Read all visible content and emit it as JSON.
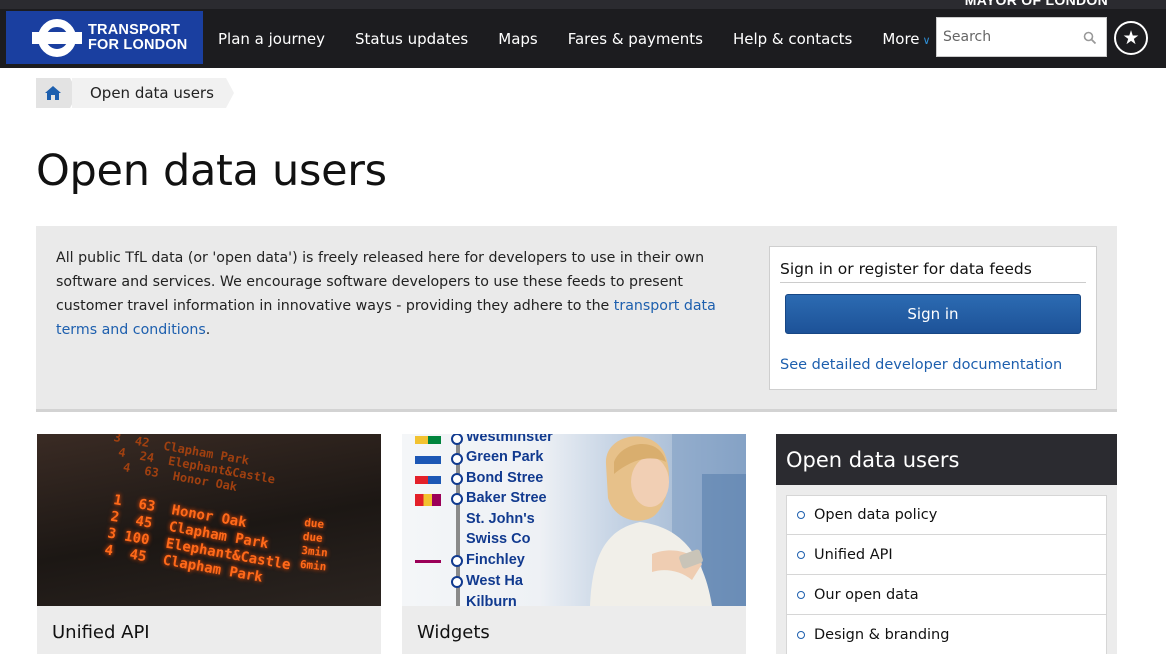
{
  "header": {
    "mayor_text": "MAYOR OF LONDON",
    "logo_line1": "TRANSPORT",
    "logo_line2": "FOR LONDON",
    "nav": [
      {
        "label": "Plan a journey"
      },
      {
        "label": "Status updates"
      },
      {
        "label": "Maps"
      },
      {
        "label": "Fares & payments"
      },
      {
        "label": "Help & contacts"
      },
      {
        "label": "More"
      }
    ],
    "search_placeholder": "Search",
    "search_value": ""
  },
  "breadcrumb": {
    "current": "Open data users"
  },
  "page": {
    "title": "Open data users"
  },
  "intro": {
    "text": "All public TfL data (or 'open data') is freely released here for developers to use in their own software and services. We encourage software developers to use these feeds to present customer travel information in innovative ways - providing they adhere to the ",
    "link_text": "transport data terms and conditions",
    "text_end": "."
  },
  "signin": {
    "heading": "Sign in or register for data feeds",
    "button_label": "Sign in",
    "doc_link": "See detailed developer documentation"
  },
  "cards": [
    {
      "title": "Unified API"
    },
    {
      "title": "Widgets"
    }
  ],
  "board": {
    "rows": [
      {
        "num": "1",
        "mins": "63",
        "dest": "Honor Oak",
        "status": "due"
      },
      {
        "num": "2",
        "mins": "45",
        "dest": "Clapham Park",
        "status": "due"
      },
      {
        "num": "3",
        "mins": "100",
        "dest": "Elephant&Castle",
        "status": "3min"
      },
      {
        "num": "4",
        "mins": "45",
        "dest": "Clapham Park",
        "status": "6min"
      }
    ]
  },
  "tube_stations": [
    "Westminster",
    "Green Park",
    "Bond Stree",
    "Baker Stree",
    "St. John's",
    "Swiss Co",
    "Finchley",
    "West Ha",
    "Kilburn"
  ],
  "sidebar": {
    "heading": "Open data users",
    "items": [
      {
        "label": "Open data policy"
      },
      {
        "label": "Unified API"
      },
      {
        "label": "Our open data"
      },
      {
        "label": "Design & branding"
      }
    ]
  },
  "colors": {
    "brand_blue": "#1a3fa0",
    "nav_bg": "#1c1c1f",
    "link_blue": "#1d5fae",
    "button_blue": "#1d5298"
  }
}
